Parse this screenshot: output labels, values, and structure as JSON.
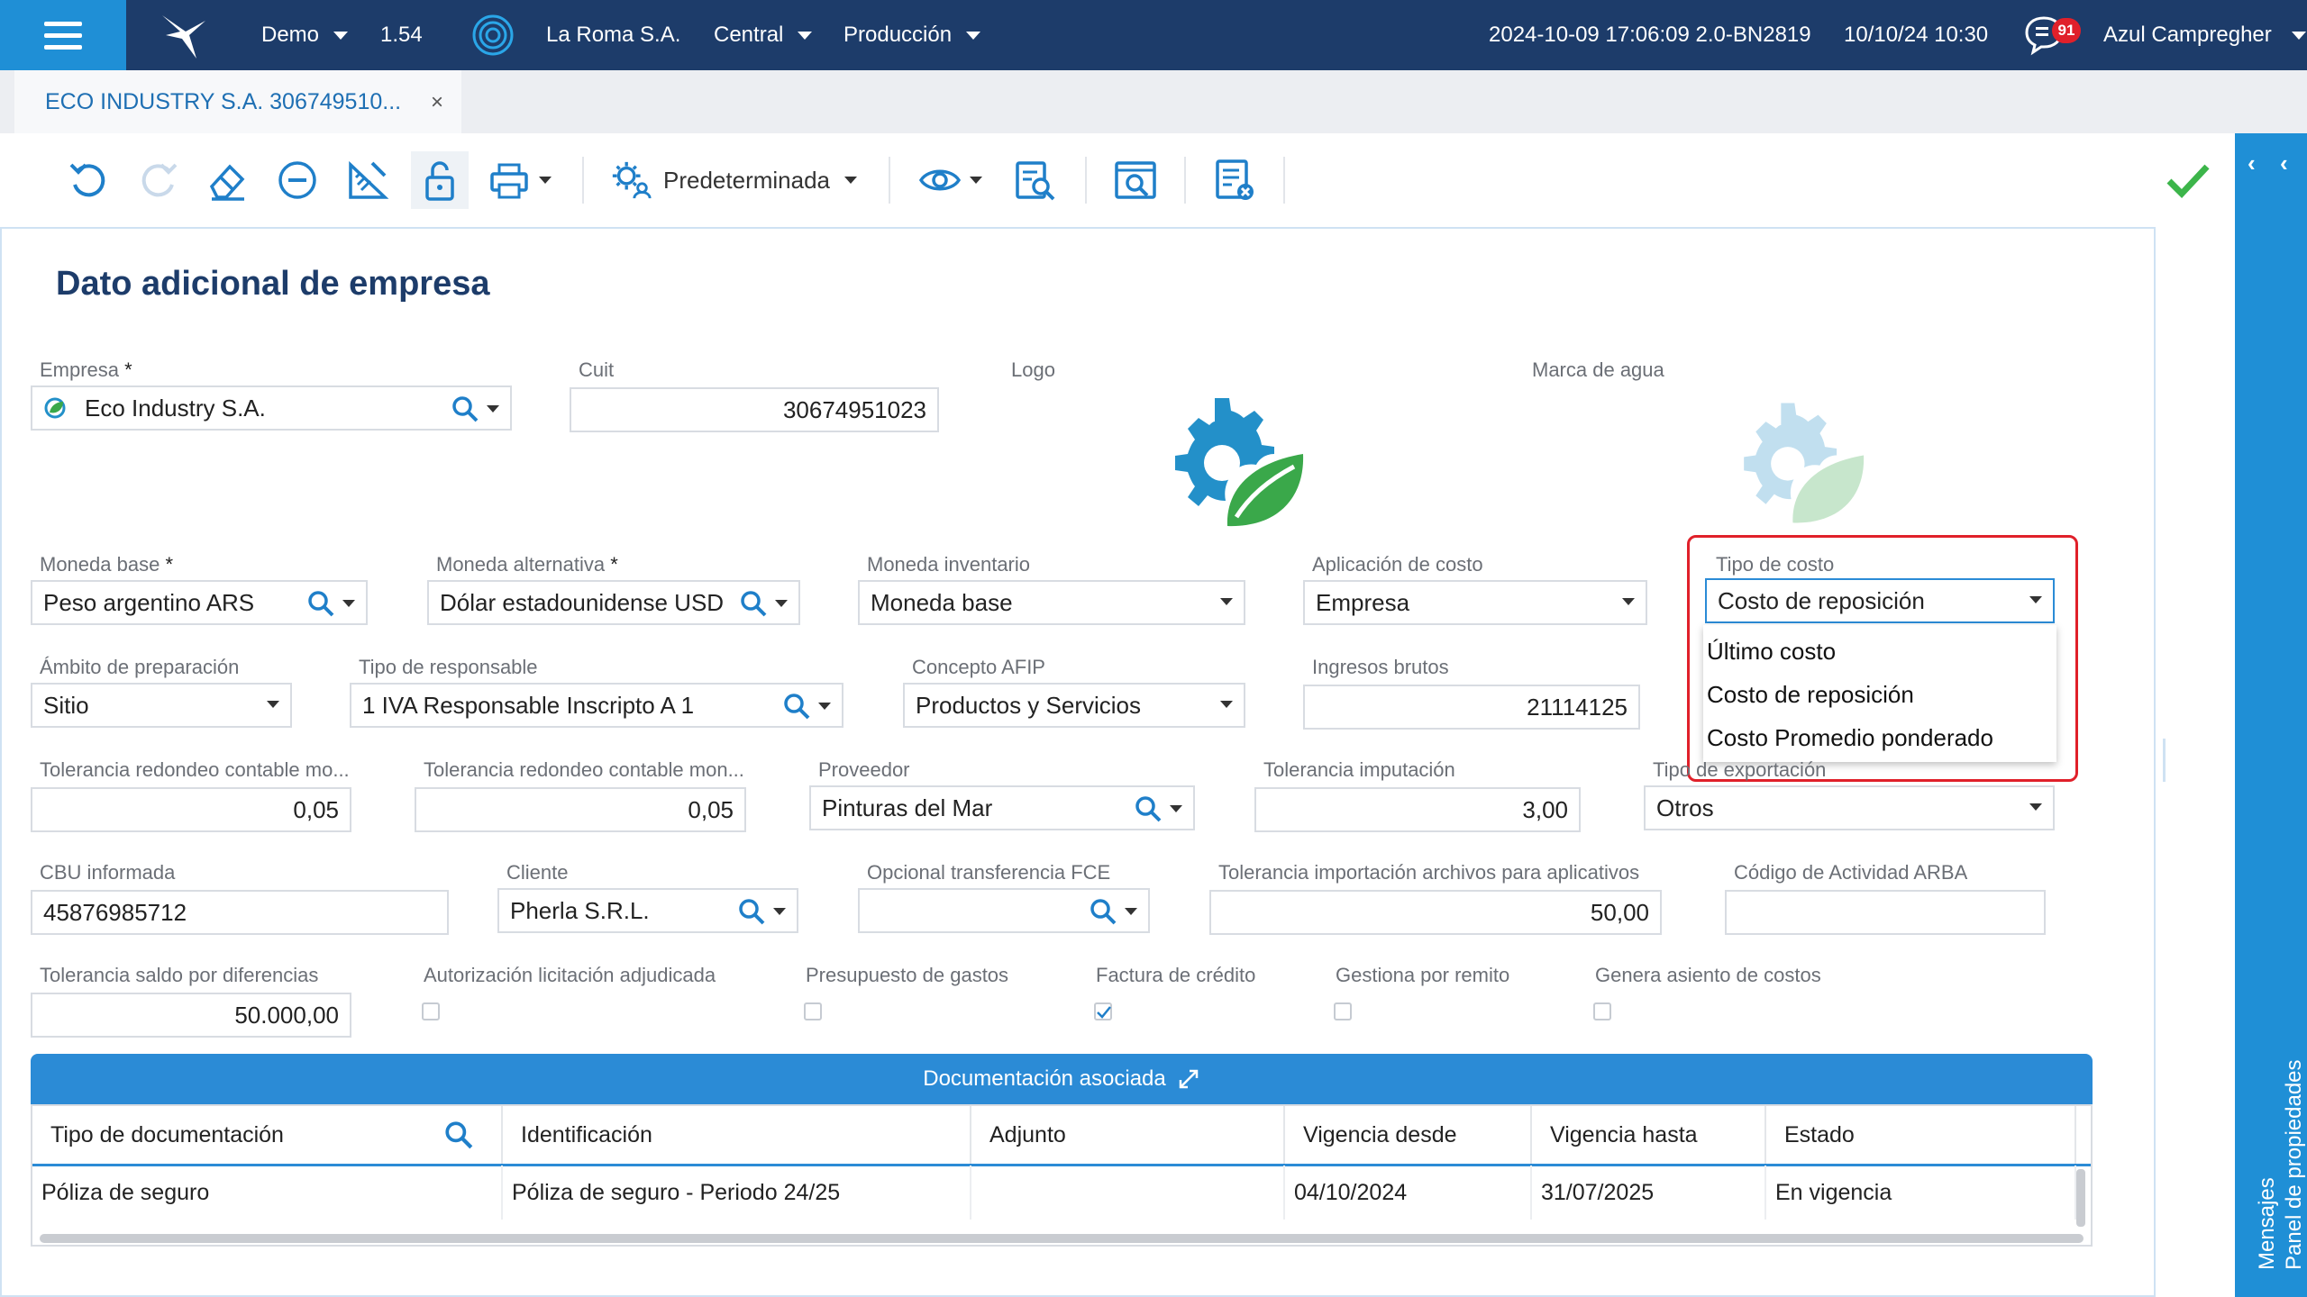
{
  "topbar": {
    "environment": "Demo",
    "version": "1.54",
    "company": "La Roma S.A.",
    "branch": "Central",
    "module": "Producción",
    "build": "2024-10-09 17:06:09 2.0-BN2819",
    "datetime": "10/10/24 10:30",
    "notifications": "91",
    "user": "Azul Campregher"
  },
  "tab": {
    "title": "ECO INDUSTRY S.A. 306749510...",
    "close": "×"
  },
  "toolbar": {
    "view_label": "Predeterminada"
  },
  "side_panel": {
    "properties": "Panel de propiedades",
    "messages": "Mensajes"
  },
  "page": {
    "title": "Dato adicional de empresa"
  },
  "form": {
    "empresa": {
      "label": "Empresa",
      "value": "Eco Industry S.A."
    },
    "cuit": {
      "label": "Cuit",
      "value": "30674951023"
    },
    "logo": {
      "label": "Logo"
    },
    "marca_agua": {
      "label": "Marca de agua"
    },
    "moneda_base": {
      "label": "Moneda base",
      "value": "Peso argentino ARS"
    },
    "moneda_alternativa": {
      "label": "Moneda alternativa",
      "value": "Dólar estadounidense USD"
    },
    "moneda_inventario": {
      "label": "Moneda inventario",
      "value": "Moneda base"
    },
    "aplicacion_costo": {
      "label": "Aplicación de costo",
      "value": "Empresa"
    },
    "tipo_costo": {
      "label": "Tipo de costo",
      "value": "Costo de reposición",
      "options": [
        "Último costo",
        "Costo de reposición",
        "Costo Promedio ponderado"
      ]
    },
    "ambito": {
      "label": "Ámbito de preparación",
      "value": "Sitio"
    },
    "tipo_responsable": {
      "label": "Tipo de responsable",
      "value": "1 IVA Responsable Inscripto A 1"
    },
    "concepto_afip": {
      "label": "Concepto AFIP",
      "value": "Productos y Servicios"
    },
    "ingresos_brutos": {
      "label": "Ingresos brutos",
      "value": "21114125"
    },
    "tol_redondeo_1": {
      "label": "Tolerancia redondeo contable mo...",
      "value": "0,05"
    },
    "tol_redondeo_2": {
      "label": "Tolerancia redondeo contable mon...",
      "value": "0,05"
    },
    "proveedor": {
      "label": "Proveedor",
      "value": "Pinturas del Mar"
    },
    "tol_imputacion": {
      "label": "Tolerancia imputación",
      "value": "3,00"
    },
    "tipo_exportacion": {
      "label": "Tipo de exportación",
      "value": "Otros"
    },
    "cbu": {
      "label": "CBU informada",
      "value": "45876985712"
    },
    "cliente": {
      "label": "Cliente",
      "value": "Pherla S.R.L."
    },
    "opcional_fce": {
      "label": "Opcional transferencia FCE",
      "value": ""
    },
    "tol_importacion": {
      "label": "Tolerancia importación archivos para aplicativos",
      "value": "50,00"
    },
    "codigo_arba": {
      "label": "Código de Actividad ARBA",
      "value": ""
    },
    "tol_saldo": {
      "label": "Tolerancia saldo por diferencias",
      "value": "50.000,00"
    },
    "chk_autorizacion": {
      "label": "Autorización licitación adjudicada",
      "checked": false
    },
    "chk_presupuesto": {
      "label": "Presupuesto de gastos",
      "checked": false
    },
    "chk_factura": {
      "label": "Factura de crédito",
      "checked": true
    },
    "chk_remito": {
      "label": "Gestiona por remito",
      "checked": false
    },
    "chk_asiento": {
      "label": "Genera asiento de costos",
      "checked": false
    }
  },
  "grid": {
    "title": "Documentación asociada",
    "columns": [
      "Tipo de documentación",
      "Identificación",
      "Adjunto",
      "Vigencia desde",
      "Vigencia hasta",
      "Estado"
    ],
    "rows": [
      [
        "Póliza de seguro",
        "Póliza de seguro - Periodo 24/25",
        "",
        "04/10/2024",
        "31/07/2025",
        "En vigencia"
      ]
    ]
  },
  "colors": {
    "topbar": "#1d3c6a",
    "accent": "#1f8fd6",
    "title": "#1d3c6a",
    "highlight": "#e0202a"
  }
}
